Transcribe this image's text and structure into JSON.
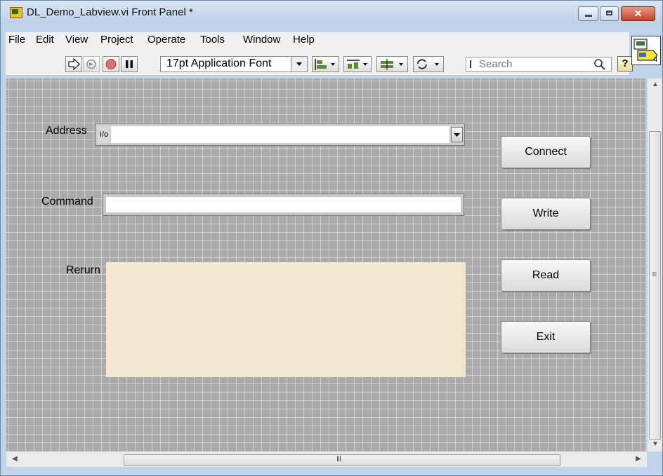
{
  "window": {
    "title": "DL_Demo_Labview.vi Front Panel *",
    "close_glyph": "✕"
  },
  "menu": [
    {
      "label": "File"
    },
    {
      "label": "Edit"
    },
    {
      "label": "View"
    },
    {
      "label": "Project"
    },
    {
      "label": "Operate"
    },
    {
      "label": "Tools"
    },
    {
      "label": "Window"
    },
    {
      "label": "Help"
    }
  ],
  "toolbar": {
    "font_select": "17pt Application Font",
    "search_placeholder": "Search",
    "help_glyph": "?",
    "icons": [
      "run-arrow-icon",
      "run-continuously-icon",
      "abort-icon",
      "pause-icon",
      "align-objects-icon",
      "distribute-objects-icon",
      "resize-objects-icon",
      "reorder-icon",
      "search-icon",
      "help-icon"
    ]
  },
  "vi_icon": {
    "connector_number": "4"
  },
  "panel": {
    "address": {
      "label": "Address",
      "io_glyph": "I/o",
      "value": ""
    },
    "command": {
      "label": "Command",
      "value": ""
    },
    "return": {
      "label": "Rerurn",
      "value": ""
    },
    "buttons": {
      "connect": "Connect",
      "write": "Write",
      "read": "Read",
      "exit": "Exit"
    }
  },
  "scrollbar": {
    "h_grip": "III",
    "v_grip": "≡"
  },
  "colors": {
    "panel_bg": "#aaaaaa",
    "return_indicator_bg": "#f3e8cf",
    "title_bar": "#c7d8ee",
    "close_button": "#c8452c"
  }
}
